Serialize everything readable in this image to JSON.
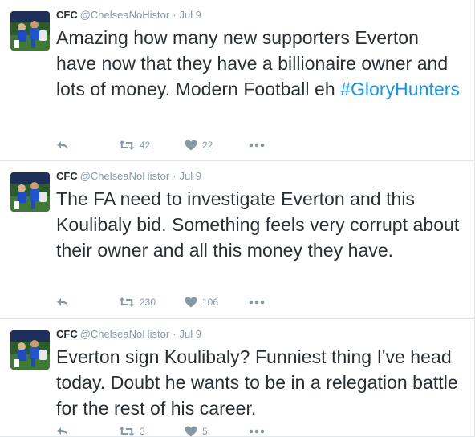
{
  "tweets": [
    {
      "name": "CFC",
      "handle": "@ChelseaNoHistor",
      "dot": "·",
      "time": "Jul 9",
      "text": "Amazing how many new supporters Everton have now that they have a billionaire owner and lots of money. Modern Football eh ",
      "hashtag": "#GloryHunters",
      "retweets": "42",
      "likes": "22"
    },
    {
      "name": "CFC",
      "handle": "@ChelseaNoHistor",
      "dot": "·",
      "time": "Jul 9",
      "text": "The FA need to investigate Everton and this Koulibaly bid. Something feels very corrupt about their owner and all this money they have.",
      "retweets": "230",
      "likes": "106"
    },
    {
      "name": "CFC",
      "handle": "@ChelseaNoHistor",
      "dot": "·",
      "time": "Jul 9",
      "text": "Everton sign Koulibaly? Funniest thing I've head today. Doubt he wants to be in a relegation battle for the rest of his career.",
      "retweets": "3",
      "likes": "5"
    }
  ],
  "icons": {
    "reply": "reply-icon",
    "retweet": "retweet-icon",
    "like": "heart-icon",
    "more": "more-dots-icon"
  },
  "colors": {
    "text": "#292f33",
    "muted": "#8899a6",
    "hashtag": "#1b95e0",
    "divider": "#e1e8ed"
  }
}
